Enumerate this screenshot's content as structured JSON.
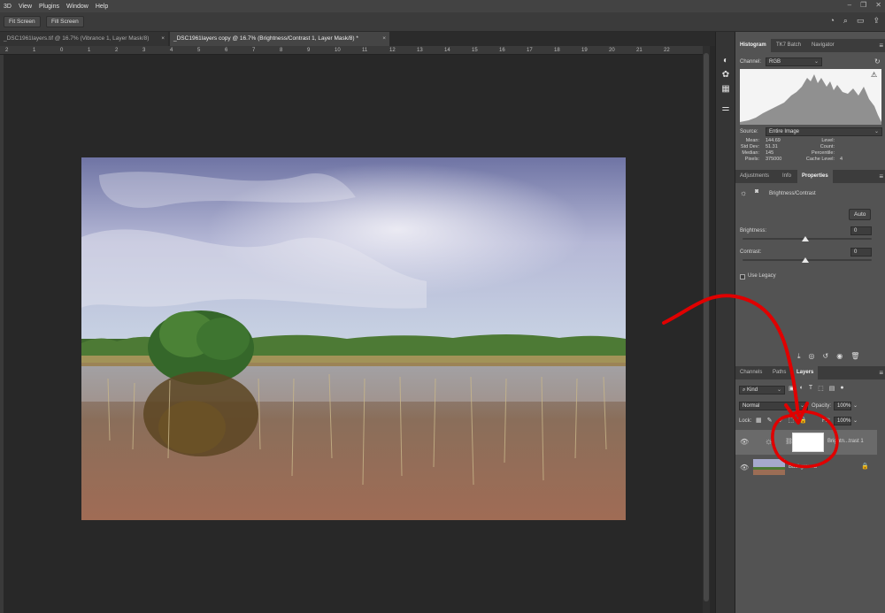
{
  "menu": [
    "3D",
    "View",
    "Plugins",
    "Window",
    "Help"
  ],
  "options_bar": {
    "fit_screen": "Fit Screen",
    "fill_screen": "Fill Screen"
  },
  "tabs": [
    {
      "label": "_DSC1961layers.tif @ 16.7% (Vibrance 1, Layer Mask/8)",
      "close": "×",
      "active": false
    },
    {
      "label": "_DSC1961layers copy @ 16.7% (Brightness/Contrast 1, Layer Mask/8) *",
      "close": "×",
      "active": true
    }
  ],
  "ruler_ticks": [
    "2",
    "1",
    "0",
    "1",
    "2",
    "3",
    "4",
    "5",
    "6",
    "7",
    "8",
    "9",
    "10",
    "11",
    "12",
    "13",
    "14",
    "15",
    "16",
    "17",
    "18",
    "19",
    "20",
    "21",
    "22"
  ],
  "histogram_panel": {
    "tabs": [
      "Histogram",
      "TK7 Batch",
      "Navigator"
    ],
    "channel_label": "Channel:",
    "channel_value": "RGB",
    "source_label": "Source:",
    "source_value": "Entire Image",
    "stats_left": [
      {
        "label": "Mean:",
        "value": "144.69"
      },
      {
        "label": "Std Dev:",
        "value": "51.31"
      },
      {
        "label": "Median:",
        "value": "145"
      },
      {
        "label": "Pixels:",
        "value": "375000"
      }
    ],
    "stats_right": [
      {
        "label": "Level:",
        "value": ""
      },
      {
        "label": "Count:",
        "value": ""
      },
      {
        "label": "Percentile:",
        "value": ""
      },
      {
        "label": "Cache Level:",
        "value": "4"
      }
    ],
    "warning_icon": "⚠"
  },
  "properties_panel": {
    "tabs": [
      "Adjustments",
      "Info",
      "Properties"
    ],
    "title": "Brightness/Contrast",
    "auto_button": "Auto",
    "brightness_label": "Brightness:",
    "brightness_value": "0",
    "contrast_label": "Contrast:",
    "contrast_value": "0",
    "use_legacy": "Use Legacy"
  },
  "layers_panel": {
    "tabs": [
      "Channels",
      "Paths",
      "Layers"
    ],
    "filter_kind": "Kind",
    "blend_mode": "Normal",
    "opacity_label": "Opacity:",
    "opacity_value": "100%",
    "lock_label": "Lock:",
    "fill_label": "Fill:",
    "fill_value": "100%",
    "layers": [
      {
        "name": "Brightn...trast 1",
        "selected": true
      },
      {
        "name": "Background",
        "selected": false
      }
    ]
  },
  "colors": {
    "annotation_red": "#e00000",
    "panel_bg": "#535353",
    "selected_layer": "#6a6a6a"
  }
}
